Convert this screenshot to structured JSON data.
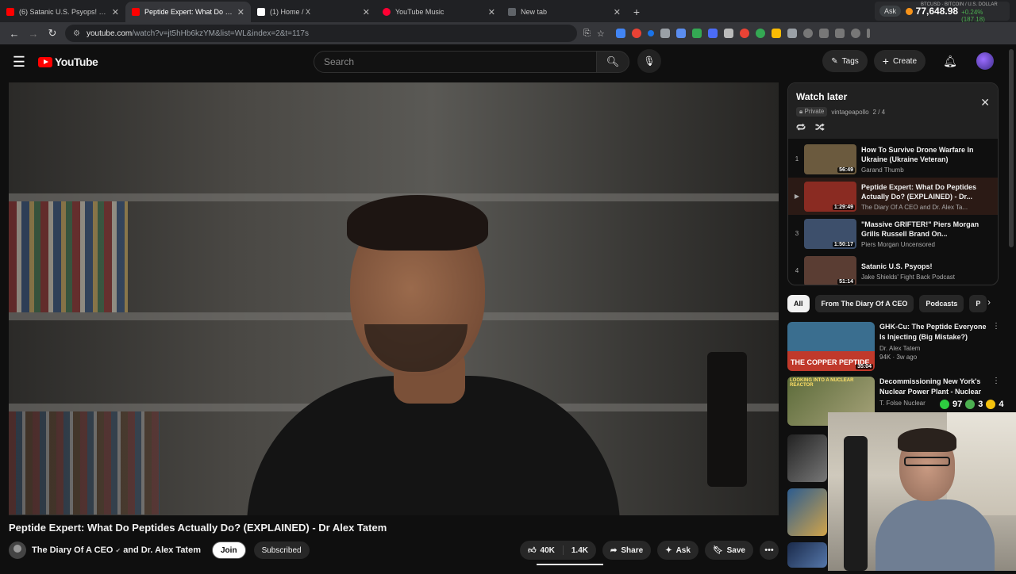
{
  "browser": {
    "tabs": [
      {
        "title": "(6) Satanic U.S. Psyops! - YouTube",
        "favicon_color": "#ff0000",
        "active": false
      },
      {
        "title": "Peptide Expert: What Do Peptides Actually Do?",
        "favicon_color": "#ff0000",
        "active": true
      },
      {
        "title": "(1) Home / X",
        "favicon_color": "#ffffff",
        "active": false
      },
      {
        "title": "YouTube Music",
        "favicon_color": "#ff0033",
        "active": false
      },
      {
        "title": "New tab",
        "favicon_color": "#5f6368",
        "active": false
      }
    ],
    "new_tab": "+",
    "url_host": "youtube.com",
    "url_rest": "/watch?v=jt5hHb6kzYM&list=WL&index=2&t=117s",
    "ticker": {
      "ask": "Ask",
      "symbol": "BTCUSD",
      "sub": "BITCOIN / U.S. DOLLAR",
      "price": "77,648.98",
      "change": "+0.24% (187.18)"
    }
  },
  "youtube": {
    "logo_text": "YouTube",
    "search_placeholder": "Search",
    "tags_label": "Tags",
    "create_label": "Create"
  },
  "video": {
    "title": "Peptide Expert: What Do Peptides Actually Do? (EXPLAINED) - Dr Alex Tatem",
    "channel": "The Diary Of A CEO",
    "and_text": "and Dr. Alex Tatem",
    "join_label": "Join",
    "subscribed_label": "Subscribed",
    "likes": "40K",
    "dislikes": "1.4K",
    "share_label": "Share",
    "ask_label": "Ask",
    "save_label": "Save"
  },
  "watch_later": {
    "title": "Watch later",
    "privacy": "Private",
    "owner": "vintageapollo",
    "position": "2 / 4",
    "items": [
      {
        "index": "1",
        "title": "How To Survive Drone Warfare In Ukraine (Ukraine Veteran)",
        "channel": "Garand Thumb",
        "duration": "56:49",
        "thumb_color": "#6b5a3e",
        "current": false
      },
      {
        "index": "▶",
        "title": "Peptide Expert: What Do Peptides Actually Do? (EXPLAINED) - Dr...",
        "channel": "The Diary Of A CEO and Dr. Alex Ta...",
        "duration": "1:29:49",
        "thumb_color": "#8a2b22",
        "current": true
      },
      {
        "index": "3",
        "title": "\"Massive GRIFTER!\" Piers Morgan Grills Russell Brand On...",
        "channel": "Piers Morgan Uncensored",
        "duration": "1:50:17",
        "thumb_color": "#3d4f6b",
        "current": false
      },
      {
        "index": "4",
        "title": "Satanic U.S. Psyops!",
        "channel": "Jake Shields' Fight Back Podcast",
        "duration": "51:14",
        "thumb_color": "#5a3d33",
        "current": false
      }
    ]
  },
  "chips": [
    "All",
    "From The Diary Of A CEO",
    "Podcasts",
    "P"
  ],
  "recommendations": [
    {
      "title": "GHK-Cu: The Peptide Everyone Is Injecting (Big Mistake?)",
      "channel": "Dr. Alex Tatem",
      "stats": "94K · 3w ago",
      "duration": "35:04",
      "thumb_text": "THE COPPER PEPTIDE",
      "thumb_color": "#3a6e8f"
    },
    {
      "title": "Decommissioning New York's Nuclear Power Plant - Nuclear ...",
      "channel": "T. Folse Nuclear",
      "stats": "",
      "duration": "",
      "thumb_text": "LOOKING INTO A NUCLEAR REACTOR",
      "thumb_color": "#5c6b3a"
    }
  ],
  "overlay_counts": {
    "a": "97",
    "b": "3",
    "c": "4"
  }
}
